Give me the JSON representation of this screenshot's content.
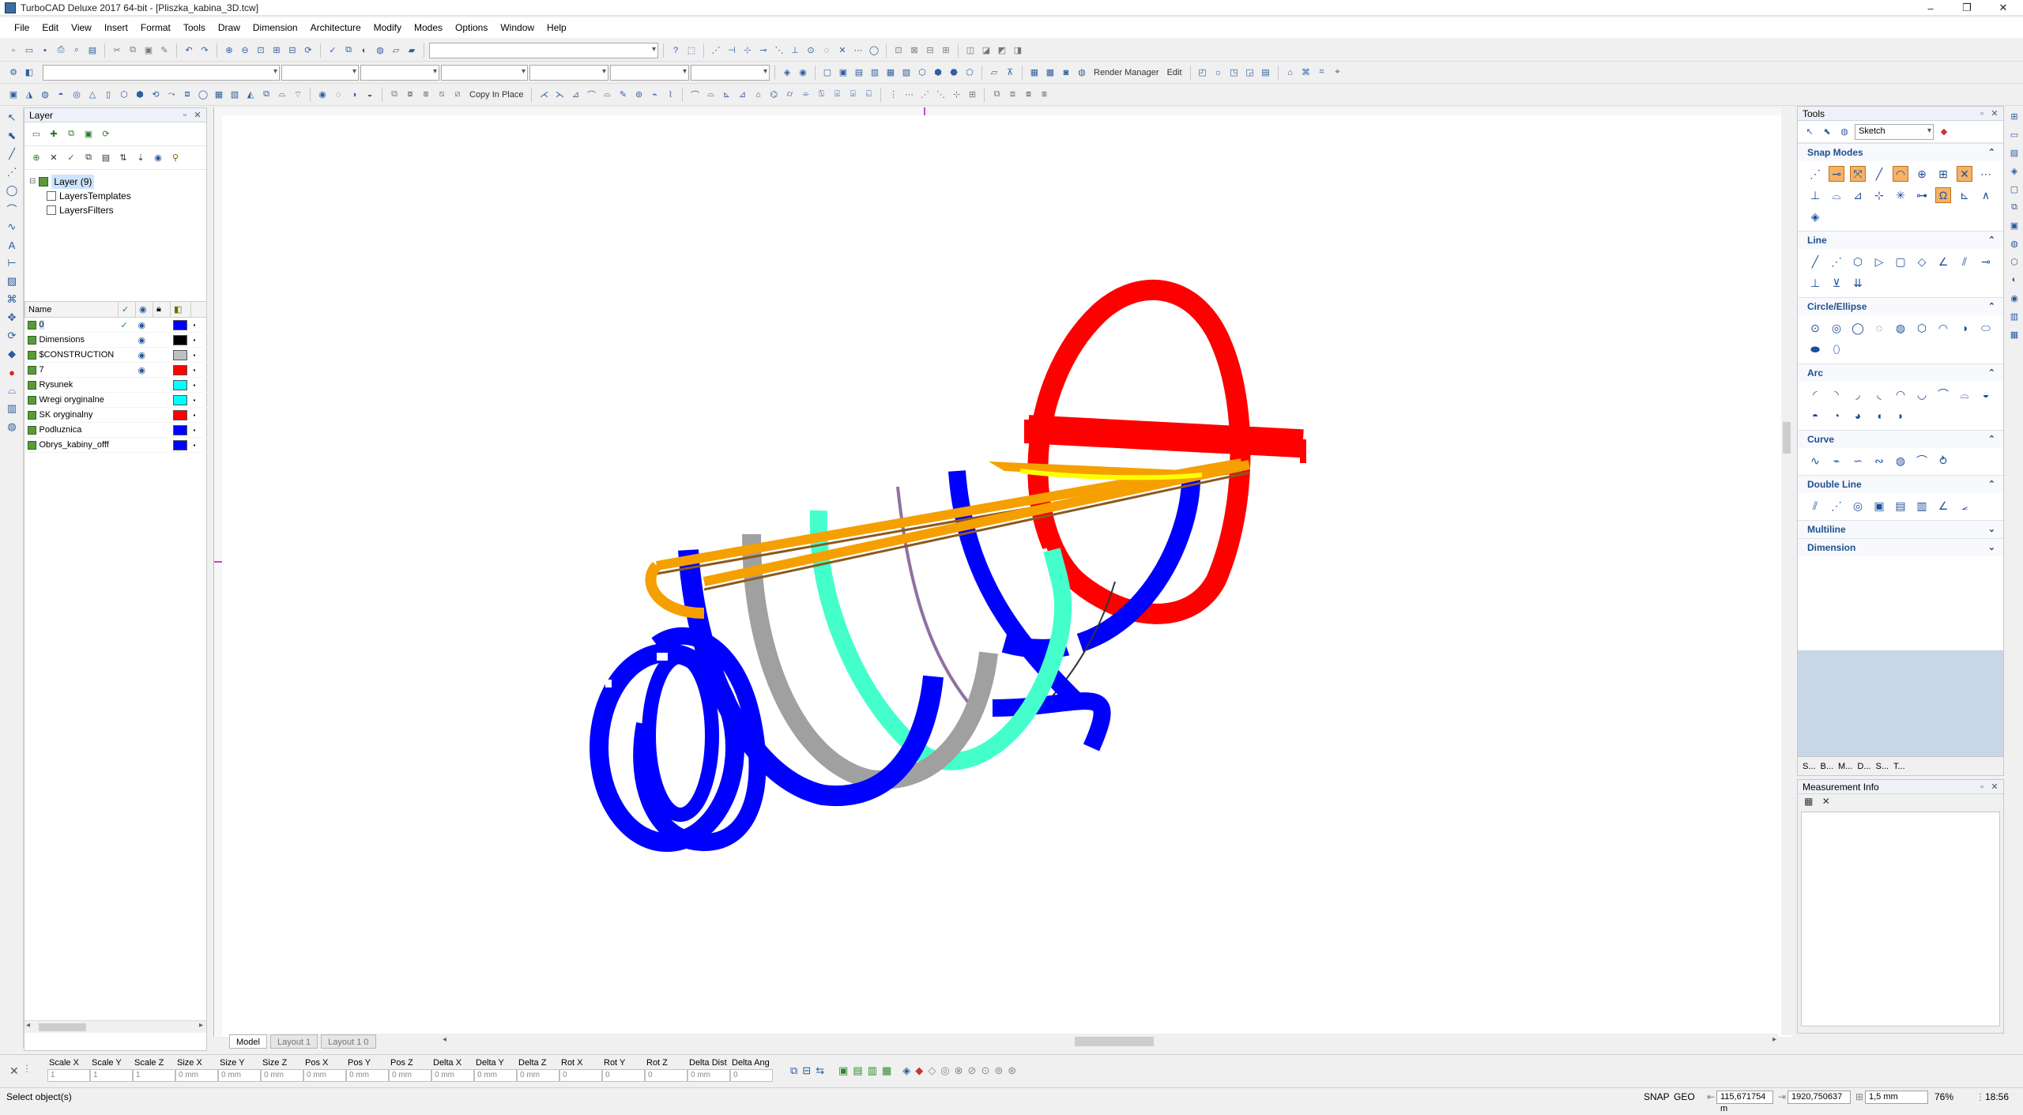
{
  "window": {
    "title": "TurboCAD Deluxe 2017 64-bit - [Pliszka_kabina_3D.tcw]",
    "controls": [
      "–",
      "❐",
      "✕"
    ]
  },
  "menu": [
    "File",
    "Edit",
    "View",
    "Insert",
    "Format",
    "Tools",
    "Draw",
    "Dimension",
    "Architecture",
    "Modify",
    "Modes",
    "Options",
    "Window",
    "Help"
  ],
  "toolbar": {
    "copy_in_place": "Copy In Place",
    "render_manager": "Render Manager",
    "edit": "Edit"
  },
  "layer_panel": {
    "title": "Layer",
    "tree": [
      {
        "label": "Layer (9)"
      },
      {
        "label": "LayersTemplates"
      },
      {
        "label": "LayersFilters"
      }
    ],
    "columns": [
      "Name"
    ],
    "rows": [
      {
        "name": "0",
        "check": "✓",
        "visible": "◉",
        "color": "#0000ff"
      },
      {
        "name": "Dimensions",
        "check": "",
        "visible": "◉",
        "color": "#000000"
      },
      {
        "name": "$CONSTRUCTION",
        "check": "",
        "visible": "◉",
        "color": "#c0c0c0"
      },
      {
        "name": "7",
        "check": "",
        "visible": "◉",
        "color": "#ff0000"
      },
      {
        "name": "Rysunek",
        "check": "",
        "visible": "",
        "color": "#00ffff"
      },
      {
        "name": "Wregi oryginalne",
        "check": "",
        "visible": "",
        "color": "#00ffff"
      },
      {
        "name": "SK oryginalny",
        "check": "",
        "visible": "",
        "color": "#ff0000"
      },
      {
        "name": "Podluznica",
        "check": "",
        "visible": "",
        "color": "#0000ff"
      },
      {
        "name": "Obrys_kabiny_offf",
        "check": "",
        "visible": "",
        "color": "#0000ff"
      }
    ]
  },
  "tabs": [
    "Model",
    "Layout 1",
    "Layout 1 0"
  ],
  "tools_panel": {
    "title": "Tools",
    "mode": "Sketch",
    "groups": [
      "Snap Modes",
      "Line",
      "Circle/Ellipse",
      "Arc",
      "Curve",
      "Double Line",
      "Multiline",
      "Dimension"
    ],
    "bottom_tabs": [
      "S...",
      "B...",
      "M...",
      "D...",
      "S...",
      "T..."
    ]
  },
  "measurement_info": {
    "title": "Measurement Info"
  },
  "inspector": {
    "fields": [
      {
        "label": "Scale X",
        "value": "1"
      },
      {
        "label": "Scale Y",
        "value": "1"
      },
      {
        "label": "Scale Z",
        "value": "1"
      },
      {
        "label": "Size X",
        "value": "0 mm"
      },
      {
        "label": "Size Y",
        "value": "0 mm"
      },
      {
        "label": "Size Z",
        "value": "0 mm"
      },
      {
        "label": "Pos X",
        "value": "0 mm"
      },
      {
        "label": "Pos Y",
        "value": "0 mm"
      },
      {
        "label": "Pos Z",
        "value": "0 mm"
      },
      {
        "label": "Delta X",
        "value": "0 mm"
      },
      {
        "label": "Delta Y",
        "value": "0 mm"
      },
      {
        "label": "Delta Z",
        "value": "0 mm"
      },
      {
        "label": "Rot X",
        "value": "0"
      },
      {
        "label": "Rot Y",
        "value": "0"
      },
      {
        "label": "Rot Z",
        "value": "0"
      },
      {
        "label": "Delta Dist",
        "value": "0 mm"
      },
      {
        "label": "Delta Ang",
        "value": "0"
      }
    ]
  },
  "status": {
    "message": "Select object(s)",
    "snap": "SNAP",
    "geo": "GEO",
    "coord_x": "115,671754 m",
    "coord_y": "1920,750637",
    "grid": "1,5 mm",
    "zoom": "76%",
    "time": "18:56"
  }
}
